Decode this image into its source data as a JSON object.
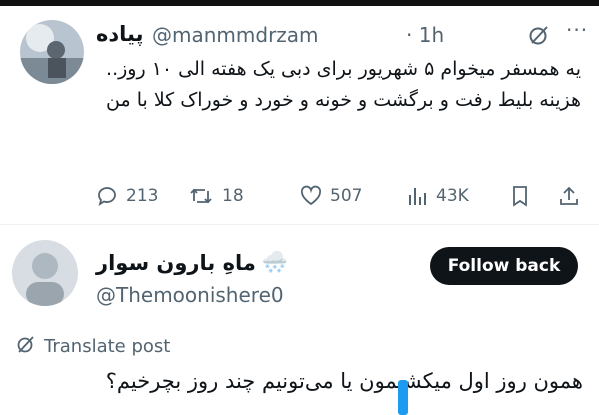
{
  "post": {
    "author_name": "پیاده",
    "author_handle": "@manmmdrzam",
    "time": "· 1h",
    "more_label": "···",
    "text": "یه همسفر میخوام ۵ شهریور برای دبی یک هفته الی ۱۰ روز.. هزینه بلیط رفت و برگشت و خونه و خورد و خوراک کلا با من",
    "stats": {
      "replies": "213",
      "reposts": "18",
      "likes": "507",
      "views": "43K"
    },
    "icons": [
      "grok-icon",
      "more-icon",
      "reply-icon",
      "repost-icon",
      "like-icon",
      "views-icon",
      "bookmark-icon",
      "share-icon"
    ]
  },
  "reply": {
    "author_name": "ماهِ بارون سوار",
    "author_emoji": "🌨️",
    "author_handle": "@Themoonishere0",
    "follow_label": "Follow back",
    "translate_label": "Translate post",
    "text": "همون روز اول میکشیمون یا می‌تونیم چند روز بچرخیم؟",
    "icons": [
      "weather-emoji-icon",
      "translate-icon"
    ]
  },
  "colors": {
    "text": "#0f1419",
    "secondary": "#536471",
    "button_bg": "#0f1419",
    "accent": "#1d9bf0"
  }
}
